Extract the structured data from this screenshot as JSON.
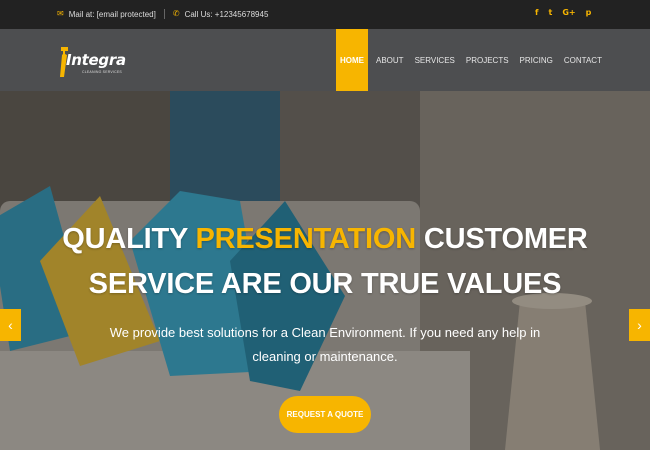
{
  "topbar": {
    "mail_text": "Mail at: [email protected]",
    "phone_text": "Call Us: +12345678945",
    "mail_icon": "envelope-icon",
    "phone_icon": "phone-icon",
    "social": [
      {
        "name": "facebook-icon",
        "glyph": "f"
      },
      {
        "name": "twitter-icon",
        "glyph": "t"
      },
      {
        "name": "google-plus-icon",
        "glyph": "G+"
      },
      {
        "name": "pinterest-icon",
        "glyph": "p"
      }
    ]
  },
  "logo": {
    "name": "Integra",
    "subtitle": "CLEANING SERVICES"
  },
  "nav": {
    "items": [
      "HOME",
      "ABOUT",
      "SERVICES",
      "PROJECTS",
      "PRICING",
      "CONTACT"
    ],
    "active": "HOME"
  },
  "hero": {
    "line1_a": "QUALITY ",
    "line1_b": "PRESENTATION",
    "line1_c": " CUSTOMER",
    "line2": "SERVICE ARE OUR TRUE VALUES",
    "description": "We provide best solutions for a Clean Environment. If you need any help in cleaning or maintenance.",
    "cta_label": "REQUEST A QUOTE",
    "prev_glyph": "‹",
    "next_glyph": "›"
  },
  "colors": {
    "accent": "#f7b500",
    "topbar_bg": "#222222",
    "header_bg": "#4d4e50"
  }
}
